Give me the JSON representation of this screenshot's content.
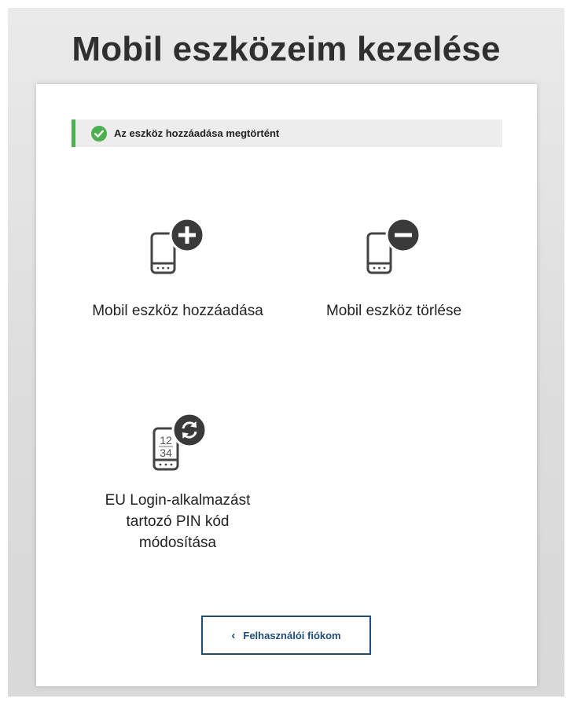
{
  "page": {
    "title": "Mobil eszközeim kezelése"
  },
  "alert": {
    "message": "Az eszköz hozzáadása megtörtént",
    "icon": "check-circle-icon",
    "color": "#4caf50"
  },
  "actions": [
    {
      "label": "Mobil eszköz hozzáadása",
      "icon": "mobile-add-icon"
    },
    {
      "label": "Mobil eszköz törlése",
      "icon": "mobile-remove-icon"
    },
    {
      "label_lines": [
        "EU Login-alkalmazást",
        "tartozó PIN kód",
        "módosítása"
      ],
      "icon": "mobile-pin-change-icon"
    }
  ],
  "pin_icon_digits": {
    "top": "12",
    "bottom": "34"
  },
  "back": {
    "label": "Felhasználói fiókom",
    "icon": "chevron-left-icon",
    "color": "#1f4d7a"
  }
}
